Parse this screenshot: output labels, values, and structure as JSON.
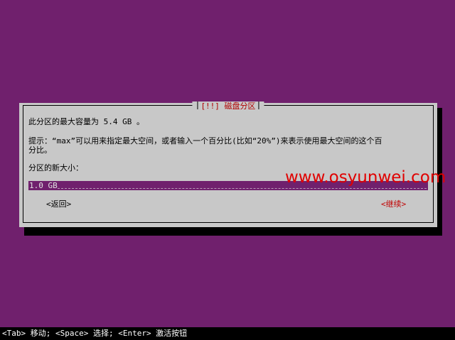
{
  "dialog": {
    "title": "[!!] 磁盘分区",
    "max_capacity_text": "此分区的最大容量为 5.4 GB 。",
    "hint_line1": "提示：“max”可以用来指定最大空间，或者输入一个百分比(比如“20%”)来表示使用最大空间的这个百",
    "hint_line2": "分比。",
    "new_size_label": "分区的新大小：",
    "new_size_value": "1.0 GB",
    "back_button": "<返回>",
    "continue_button": "<继续>"
  },
  "watermark": "www.osyunwei.com",
  "status_bar": "<Tab> 移动; <Space> 选择; <Enter> 激活按钮",
  "colors": {
    "background": "#70206d",
    "dialog": "#c8c8c8",
    "title": "#b00000",
    "highlight": "#c00000",
    "watermark": "#e00000"
  }
}
